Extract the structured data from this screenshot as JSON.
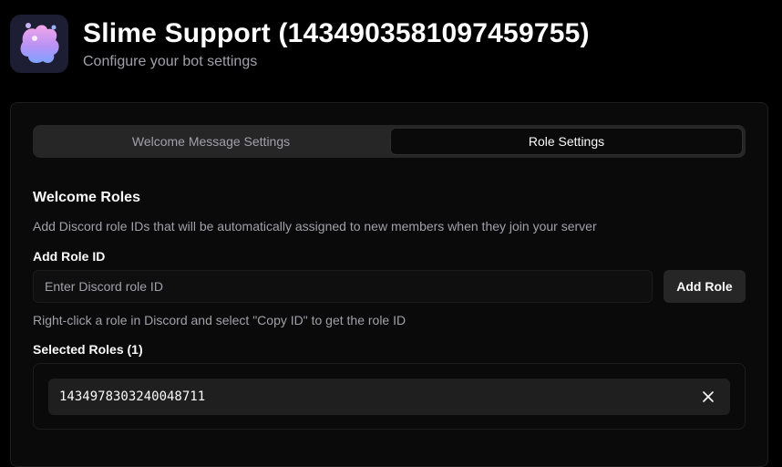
{
  "header": {
    "title": "Slime Support (1434903581097459755)",
    "subtitle": "Configure your bot settings",
    "avatar_icon": "slime-avatar-icon"
  },
  "tabs": [
    {
      "label": "Welcome Message Settings",
      "active": false
    },
    {
      "label": "Role Settings",
      "active": true
    }
  ],
  "welcome_roles": {
    "title": "Welcome Roles",
    "description": "Add Discord role IDs that will be automatically assigned to new members when they join your server",
    "add_label": "Add Role ID",
    "input_value": "",
    "input_placeholder": "Enter Discord role ID",
    "add_button_label": "Add Role",
    "hint": "Right-click a role in Discord and select \"Copy ID\" to get the role ID",
    "selected_label": "Selected Roles (1)",
    "roles": [
      {
        "id": "1434978303240048711",
        "remove_icon": "close-icon"
      }
    ]
  },
  "colors": {
    "background": "#000000",
    "card": "#0a0a0a",
    "muted_text": "#a1a1aa",
    "chip": "#1f1f1f",
    "avatar_bg": "#1d1d33"
  }
}
